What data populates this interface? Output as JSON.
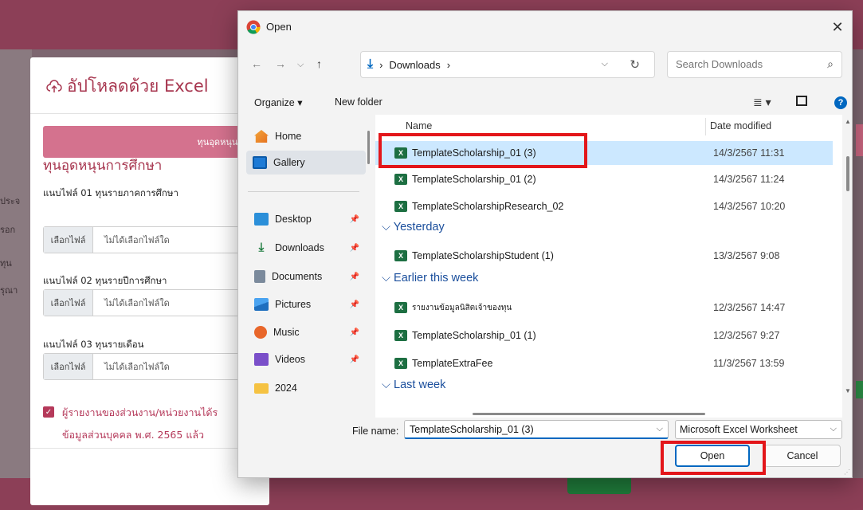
{
  "background": {
    "left_fragments": [
      "ประจ",
      "รอก",
      "ทุน",
      "รุณา"
    ]
  },
  "upload_modal": {
    "title": "อัปโหลดด้วย Excel",
    "tab_label": "ทุนอุดหนุนการศึกษ",
    "section_title": "ทุนอุดหนุนการศึกษา",
    "files": [
      {
        "label": "แนบไฟล์ 01 ทุนรายภาคการศึกษา",
        "choose": "เลือกไฟล์",
        "status": "ไม่ได้เลือกไฟล์ใด"
      },
      {
        "label": "แนบไฟล์ 02 ทุนรายปีการศึกษา",
        "choose": "เลือกไฟล์",
        "status": "ไม่ได้เลือกไฟล์ใด"
      },
      {
        "label": "แนบไฟล์ 03 ทุนรายเดือน",
        "choose": "เลือกไฟล์",
        "status": "ไม่ได้เลือกไฟล์ใด"
      }
    ],
    "consent_line1": "ผู้รายงานของส่วนงาน/หน่วยงานได้ร",
    "consent_line2": "ข้อมูลส่วนบุคคล พ.ศ. 2565 แล้ว"
  },
  "dialog": {
    "title": "Open",
    "address": {
      "crumb": "Downloads",
      "separator": "›"
    },
    "search_placeholder": "Search Downloads",
    "toolbar": {
      "organize": "Organize ▾",
      "new_folder": "New folder"
    },
    "nav": [
      {
        "label": "Home",
        "icon": "home-icon",
        "pinned": false
      },
      {
        "label": "Gallery",
        "icon": "gallery-icon",
        "pinned": false,
        "active": true
      },
      {
        "label": "Desktop",
        "icon": "desktop-icon",
        "pinned": true
      },
      {
        "label": "Downloads",
        "icon": "download-icon",
        "pinned": true
      },
      {
        "label": "Documents",
        "icon": "documents-icon",
        "pinned": true
      },
      {
        "label": "Pictures",
        "icon": "pictures-icon",
        "pinned": true
      },
      {
        "label": "Music",
        "icon": "music-icon",
        "pinned": true
      },
      {
        "label": "Videos",
        "icon": "videos-icon",
        "pinned": true
      },
      {
        "label": "2024",
        "icon": "folder-icon",
        "pinned": false
      }
    ],
    "columns": {
      "name": "Name",
      "date": "Date modified"
    },
    "groups": [
      "Yesterday",
      "Earlier this week",
      "Last week"
    ],
    "files": [
      {
        "name": "TemplateScholarship_01 (3)",
        "date": "14/3/2567 11:31",
        "selected": true
      },
      {
        "name": "TemplateScholarship_01 (2)",
        "date": "14/3/2567 11:24"
      },
      {
        "name": "TemplateScholarshipResearch_02",
        "date": "14/3/2567 10:20"
      },
      {
        "name": "TemplateScholarshipStudent (1)",
        "date": "13/3/2567 9:08"
      },
      {
        "name": "รายงานข้อมูลนิสิตเจ้าของทุน",
        "date": "12/3/2567 14:47"
      },
      {
        "name": "TemplateScholarship_01 (1)",
        "date": "12/3/2567 9:27"
      },
      {
        "name": "TemplateExtraFee",
        "date": "11/3/2567 13:59"
      }
    ],
    "file_name_label": "File name:",
    "file_name_value": "TemplateScholarship_01 (3)",
    "file_type": "Microsoft Excel Worksheet",
    "open_label": "Open",
    "cancel_label": "Cancel"
  },
  "colors": {
    "brand": "#8c3f57",
    "accent_pink": "#d4728e",
    "title_red": "#a7364f",
    "win_blue": "#0067c0",
    "selected_row": "#cce8ff",
    "highlight": "#e3161a"
  }
}
